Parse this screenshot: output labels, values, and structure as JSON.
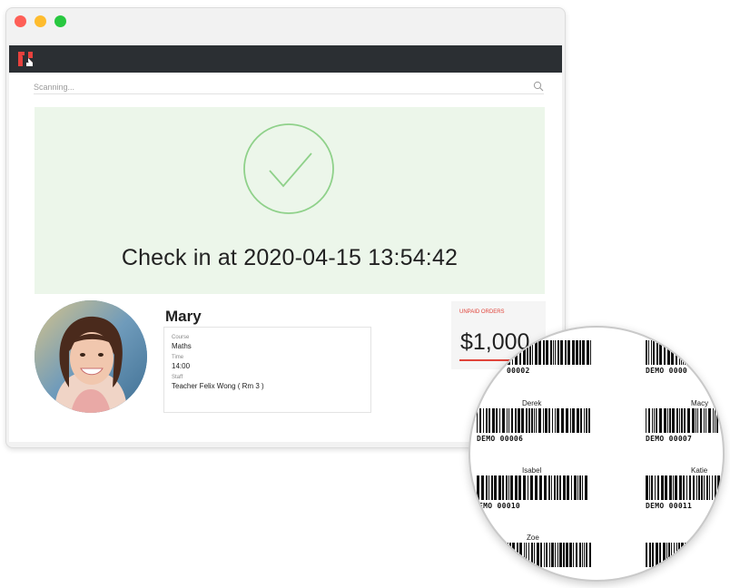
{
  "window": {
    "controls": [
      "close",
      "minimize",
      "maximize"
    ]
  },
  "topbar": {
    "logo_icon": "brand-logo-icon",
    "color": "#2b2f33"
  },
  "search": {
    "placeholder": "Scanning...",
    "icon": "search-icon"
  },
  "checkin": {
    "icon": "check-circle-icon",
    "message": "Check in at 2020-04-15 13:54:42",
    "background": "#ecf6ea",
    "accent": "#8fd18a"
  },
  "student": {
    "name": "Mary",
    "avatar_icon": "student-photo-avatar",
    "details": [
      {
        "label": "Course",
        "value": "Maths"
      },
      {
        "label": "Time",
        "value": "14:00"
      },
      {
        "label": "Staff",
        "value": "Teacher Felix Wong ( Rm 3 )"
      }
    ]
  },
  "unpaid": {
    "label": "UNPAID ORDERS",
    "amount": "$1,000",
    "accent": "#e0443a"
  },
  "barcode_sheet": {
    "tags": [
      {
        "name": "",
        "code": "00002"
      },
      {
        "name": "",
        "code": "DEMO 0000"
      },
      {
        "name": "Derek",
        "code": "DEMO 00006"
      },
      {
        "name": "Macy",
        "code": "DEMO 00007"
      },
      {
        "name": "Isabel",
        "code": "EMO 00010"
      },
      {
        "name": "Katie",
        "code": "DEMO 00011"
      },
      {
        "name": "Zoe",
        "code": ""
      },
      {
        "name": "",
        "code": ""
      }
    ]
  }
}
